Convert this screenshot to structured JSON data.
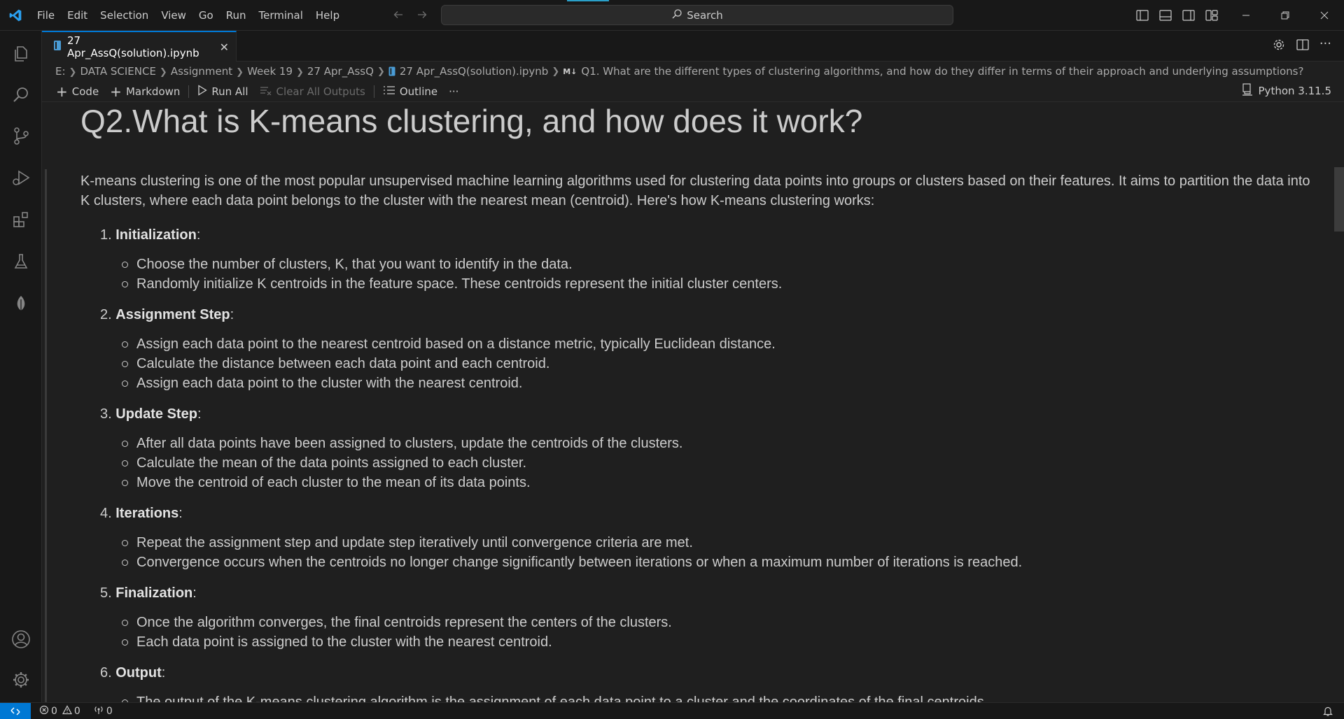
{
  "menu": [
    "File",
    "Edit",
    "Selection",
    "View",
    "Go",
    "Run",
    "Terminal",
    "Help"
  ],
  "search": {
    "label": "Search"
  },
  "tab": {
    "title": "27 Apr_AssQ(solution).ipynb"
  },
  "breadcrumb": {
    "items": [
      "E:",
      "DATA SCIENCE",
      "Assignment",
      "Week 19",
      "27 Apr_AssQ"
    ],
    "file": "27 Apr_AssQ(solution).ipynb",
    "md_badge": "M↓",
    "section": "Q1. What are the different types of clustering algorithms, and how do they differ in terms of their approach and underlying assumptions?"
  },
  "toolbar": {
    "code": "Code",
    "markdown": "Markdown",
    "run_all": "Run All",
    "clear_outputs": "Clear All Outputs",
    "outline": "Outline",
    "more": "···",
    "kernel": "Python 3.11.5"
  },
  "cell": {
    "heading": "Q2.What is K-means clustering, and how does it work?",
    "intro": "K-means clustering is one of the most popular unsupervised machine learning algorithms used for clustering data points into groups or clusters based on their features. It aims to partition the data into K clusters, where each data point belongs to the cluster with the nearest mean (centroid). Here's how K-means clustering works:",
    "steps": [
      {
        "num": "1.",
        "title": "Initialization",
        "items": [
          "Choose the number of clusters, K, that you want to identify in the data.",
          "Randomly initialize K centroids in the feature space. These centroids represent the initial cluster centers."
        ]
      },
      {
        "num": "2.",
        "title": "Assignment Step",
        "items": [
          "Assign each data point to the nearest centroid based on a distance metric, typically Euclidean distance.",
          "Calculate the distance between each data point and each centroid.",
          "Assign each data point to the cluster with the nearest centroid."
        ]
      },
      {
        "num": "3.",
        "title": "Update Step",
        "items": [
          "After all data points have been assigned to clusters, update the centroids of the clusters.",
          "Calculate the mean of the data points assigned to each cluster.",
          "Move the centroid of each cluster to the mean of its data points."
        ]
      },
      {
        "num": "4.",
        "title": "Iterations",
        "items": [
          "Repeat the assignment step and update step iteratively until convergence criteria are met.",
          "Convergence occurs when the centroids no longer change significantly between iterations or when a maximum number of iterations is reached."
        ]
      },
      {
        "num": "5.",
        "title": "Finalization",
        "items": [
          "Once the algorithm converges, the final centroids represent the centers of the clusters.",
          "Each data point is assigned to the cluster with the nearest centroid."
        ]
      },
      {
        "num": "6.",
        "title": "Output",
        "items": [
          "The output of the K-means clustering algorithm is the assignment of each data point to a cluster and the coordinates of the final centroids."
        ]
      }
    ]
  },
  "statusbar": {
    "errors": "0",
    "warnings": "0",
    "ports": "0"
  },
  "colors": {
    "accent": "#0078d4",
    "background": "#1f1f1f",
    "chrome": "#181818"
  }
}
